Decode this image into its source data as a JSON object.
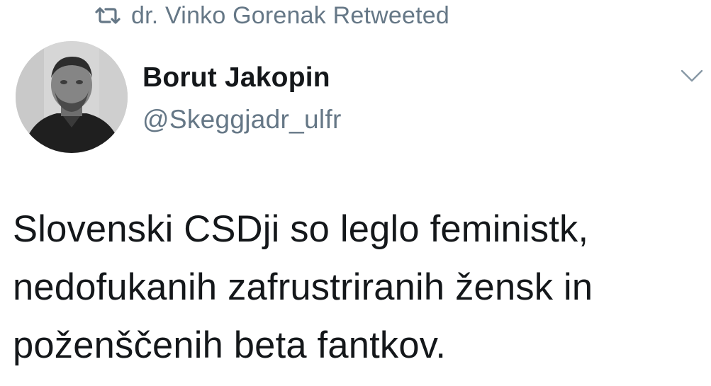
{
  "social_context": {
    "icon": "retweet-icon",
    "text": "dr. Vinko Gorenak Retweeted"
  },
  "author": {
    "display_name": "Borut Jakopin",
    "handle": "@Skeggjadr_ulfr"
  },
  "menu": {
    "icon": "chevron-down-icon"
  },
  "tweet": {
    "lines": [
      "Slovenski CSDji so leglo feministk,",
      "nedofukanih zafrustriranih žensk in",
      "poženščenih beta fantkov."
    ]
  },
  "colors": {
    "text_primary": "#14171a",
    "text_secondary": "#657786",
    "background": "#ffffff"
  }
}
